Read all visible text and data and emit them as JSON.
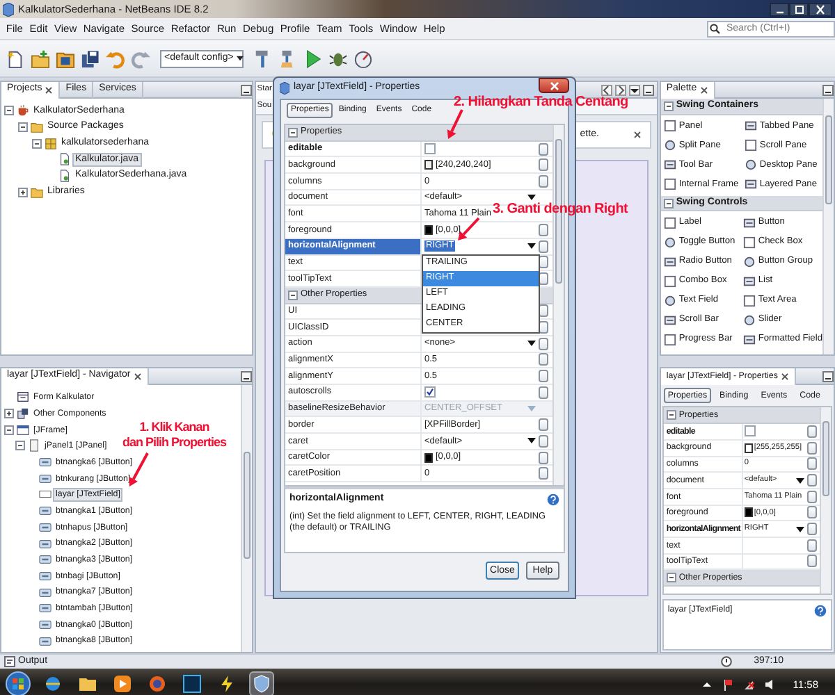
{
  "window": {
    "title": "KalkulatorSederhana - NetBeans IDE 8.2"
  },
  "menu": [
    "File",
    "Edit",
    "View",
    "Navigate",
    "Source",
    "Refactor",
    "Run",
    "Debug",
    "Profile",
    "Team",
    "Tools",
    "Window",
    "Help"
  ],
  "search": {
    "placeholder": "Search (Ctrl+I)"
  },
  "toolbar": {
    "config": "<default config>"
  },
  "projects": {
    "tabs": [
      {
        "label": "Projects",
        "selected": true
      },
      {
        "label": "Files",
        "selected": false
      },
      {
        "label": "Services",
        "selected": false
      }
    ],
    "tree": [
      {
        "label": "KalkulatorSederhana",
        "kind": "project",
        "expanded": true,
        "selected": false,
        "children": [
          {
            "label": "Source Packages",
            "kind": "folder",
            "expanded": true,
            "selected": false,
            "children": [
              {
                "label": "kalkulatorsederhana",
                "kind": "package",
                "expanded": true,
                "selected": false,
                "children": [
                  {
                    "label": "Kalkulator.java",
                    "kind": "java",
                    "selected": true
                  },
                  {
                    "label": "KalkulatorSederhana.java",
                    "kind": "java",
                    "selected": false
                  }
                ]
              }
            ]
          },
          {
            "label": "Libraries",
            "kind": "folder",
            "expanded": false,
            "selected": false
          }
        ]
      }
    ]
  },
  "navigator": {
    "title": "layar [JTextField] - Navigator",
    "tree": [
      {
        "label": "Form Kalkulator",
        "kind": "form",
        "selected": false
      },
      {
        "label": "Other Components",
        "kind": "components",
        "expanded": false,
        "selected": false
      },
      {
        "label": "[JFrame]",
        "kind": "frame",
        "expanded": true,
        "selected": false,
        "children": [
          {
            "label": "jPanel1 [JPanel]",
            "kind": "panel",
            "expanded": true,
            "selected": false,
            "children": [
              {
                "label": "btnangka6 [JButton]",
                "kind": "button",
                "selected": false
              },
              {
                "label": "btnkurang [JButton]",
                "kind": "button",
                "selected": false
              },
              {
                "label": "layar [JTextField]",
                "kind": "textfield",
                "selected": true
              },
              {
                "label": "btnangka1 [JButton]",
                "kind": "button",
                "selected": false
              },
              {
                "label": "btnhapus [JButton]",
                "kind": "button",
                "selected": false
              },
              {
                "label": "btnangka2 [JButton]",
                "kind": "button",
                "selected": false
              },
              {
                "label": "btnangka3 [JButton]",
                "kind": "button",
                "selected": false
              },
              {
                "label": "btnbagi [JButton]",
                "kind": "button",
                "selected": false
              },
              {
                "label": "btnangka7 [JButton]",
                "kind": "button",
                "selected": false
              },
              {
                "label": "btntambah [JButton]",
                "kind": "button",
                "selected": false
              },
              {
                "label": "btnangka0 [JButton]",
                "kind": "button",
                "selected": false
              },
              {
                "label": "btnangka8 [JButton]",
                "kind": "button",
                "selected": false
              }
            ]
          }
        ]
      }
    ]
  },
  "editor": {
    "tab": "Star",
    "view_tab": "Sou",
    "hint": "ette."
  },
  "palette": {
    "title": "Palette",
    "sections": [
      {
        "title": "Swing Containers",
        "expanded": true,
        "items": [
          "Panel",
          "Tabbed Pane",
          "Split Pane",
          "Scroll Pane",
          "Tool Bar",
          "Desktop Pane",
          "Internal Frame",
          "Layered Pane"
        ]
      },
      {
        "title": "Swing Controls",
        "expanded": true,
        "items": [
          "Label",
          "Button",
          "Toggle Button",
          "Check Box",
          "Radio Button",
          "Button Group",
          "Combo Box",
          "List",
          "Text Field",
          "Text Area",
          "Scroll Bar",
          "Slider",
          "Progress Bar",
          "Formatted Field"
        ]
      }
    ]
  },
  "properties": {
    "title": "layar [JTextField] - Properties",
    "tabs": [
      {
        "label": "Properties",
        "selected": true
      },
      {
        "label": "Binding",
        "selected": false
      },
      {
        "label": "Events",
        "selected": false
      },
      {
        "label": "Code",
        "selected": false
      }
    ],
    "sections": [
      {
        "title": "Properties",
        "expanded": true,
        "rows": [
          {
            "name": "editable",
            "kind": "check",
            "checked": false,
            "modified": true,
            "selected": false,
            "disabled": false
          },
          {
            "name": "background",
            "kind": "color",
            "color": "#ffffff",
            "value": "[255,255,255]",
            "modified": false,
            "selected": false,
            "disabled": false
          },
          {
            "name": "columns",
            "kind": "text",
            "value": "0",
            "modified": false,
            "selected": false,
            "disabled": false
          },
          {
            "name": "document",
            "kind": "combo",
            "value": "<default>",
            "modified": false,
            "selected": false,
            "disabled": false
          },
          {
            "name": "font",
            "kind": "text",
            "value": "Tahoma 11 Plain",
            "modified": false,
            "selected": false,
            "disabled": false
          },
          {
            "name": "foreground",
            "kind": "color",
            "color": "#000000",
            "value": "[0,0,0]",
            "modified": false,
            "selected": false,
            "disabled": false
          },
          {
            "name": "horizontalAlignment",
            "kind": "combo",
            "value": "RIGHT",
            "modified": true,
            "selected": false,
            "disabled": false
          },
          {
            "name": "text",
            "kind": "text",
            "modified": false,
            "selected": false,
            "disabled": false
          },
          {
            "name": "toolTipText",
            "kind": "text",
            "modified": false,
            "selected": false,
            "disabled": false
          }
        ]
      },
      {
        "title": "Other Properties",
        "expanded": true
      }
    ],
    "description": "layar [JTextField]"
  },
  "dialog": {
    "title": "layar [JTextField] - Properties",
    "tabs": [
      {
        "label": "Properties",
        "selected": true
      },
      {
        "label": "Binding",
        "selected": false
      },
      {
        "label": "Events",
        "selected": false
      },
      {
        "label": "Code",
        "selected": false
      }
    ],
    "sections": [
      {
        "title": "Properties",
        "expanded": true,
        "rows": [
          {
            "name": "editable",
            "kind": "check",
            "checked": false,
            "modified": true,
            "selected": false,
            "disabled": false
          },
          {
            "name": "background",
            "kind": "color",
            "color": "#f0f0f0",
            "value": "[240,240,240]",
            "modified": false,
            "selected": false,
            "disabled": false
          },
          {
            "name": "columns",
            "kind": "text",
            "value": "0",
            "modified": false,
            "selected": false,
            "disabled": false
          },
          {
            "name": "document",
            "kind": "combo",
            "value": "<default>",
            "modified": false,
            "selected": false,
            "disabled": false
          },
          {
            "name": "font",
            "kind": "text",
            "value": "Tahoma 11 Plain",
            "modified": false,
            "selected": false,
            "disabled": false
          },
          {
            "name": "foreground",
            "kind": "color",
            "color": "#000000",
            "value": "[0,0,0]",
            "modified": false,
            "selected": false,
            "disabled": false
          },
          {
            "name": "horizontalAlignment",
            "kind": "combo",
            "value": "RIGHT",
            "modified": true,
            "selected": true,
            "disabled": false,
            "options": [
              {
                "label": "TRAILING",
                "selected": false
              },
              {
                "label": "RIGHT",
                "selected": true
              },
              {
                "label": "LEFT",
                "selected": false
              },
              {
                "label": "LEADING",
                "selected": false
              },
              {
                "label": "CENTER",
                "selected": false
              }
            ]
          },
          {
            "name": "text",
            "kind": "text",
            "modified": false,
            "selected": false,
            "disabled": false
          },
          {
            "name": "toolTipText",
            "kind": "text",
            "modified": false,
            "selected": false,
            "disabled": false
          }
        ]
      },
      {
        "title": "Other Properties",
        "expanded": true,
        "rows": [
          {
            "name": "UI",
            "kind": "text",
            "modified": false,
            "selected": false,
            "disabled": false
          },
          {
            "name": "UIClassID",
            "kind": "text",
            "modified": false,
            "selected": false,
            "disabled": false
          },
          {
            "name": "action",
            "kind": "combo",
            "value": "<none>",
            "modified": false,
            "selected": false,
            "disabled": false
          },
          {
            "name": "alignmentX",
            "kind": "text",
            "value": "0.5",
            "modified": false,
            "selected": false,
            "disabled": false
          },
          {
            "name": "alignmentY",
            "kind": "text",
            "value": "0.5",
            "modified": false,
            "selected": false,
            "disabled": false
          },
          {
            "name": "autoscrolls",
            "kind": "check",
            "checked": true,
            "modified": false,
            "selected": false,
            "disabled": false
          },
          {
            "name": "baselineResizeBehavior",
            "kind": "combo",
            "value": "CENTER_OFFSET",
            "modified": false,
            "selected": false,
            "disabled": true
          },
          {
            "name": "border",
            "kind": "text",
            "value": "[XPFillBorder]",
            "modified": false,
            "selected": false,
            "disabled": false
          },
          {
            "name": "caret",
            "kind": "combo",
            "value": "<default>",
            "modified": false,
            "selected": false,
            "disabled": false
          },
          {
            "name": "caretColor",
            "kind": "color",
            "color": "#000000",
            "value": "[0,0,0]",
            "modified": false,
            "selected": false,
            "disabled": false
          },
          {
            "name": "caretPosition",
            "kind": "text",
            "value": "0",
            "modified": false,
            "selected": false,
            "disabled": false
          }
        ]
      }
    ],
    "description": {
      "title": "horizontalAlignment",
      "text": "(int) Set the field alignment to LEFT, CENTER, RIGHT, LEADING (the default) or TRAILING"
    },
    "buttons": [
      "Close",
      "Help"
    ]
  },
  "status_bar": {
    "output": "Output",
    "position": "397:10"
  },
  "taskbar": {
    "clock": "11:58"
  },
  "annotations": [
    {
      "lines": [
        "2. Hilangkan Tanda Centang"
      ]
    },
    {
      "lines": [
        "3. Ganti dengan Right"
      ]
    },
    {
      "lines": [
        "1. Klik Kanan",
        "dan Pilih Properties"
      ]
    }
  ]
}
